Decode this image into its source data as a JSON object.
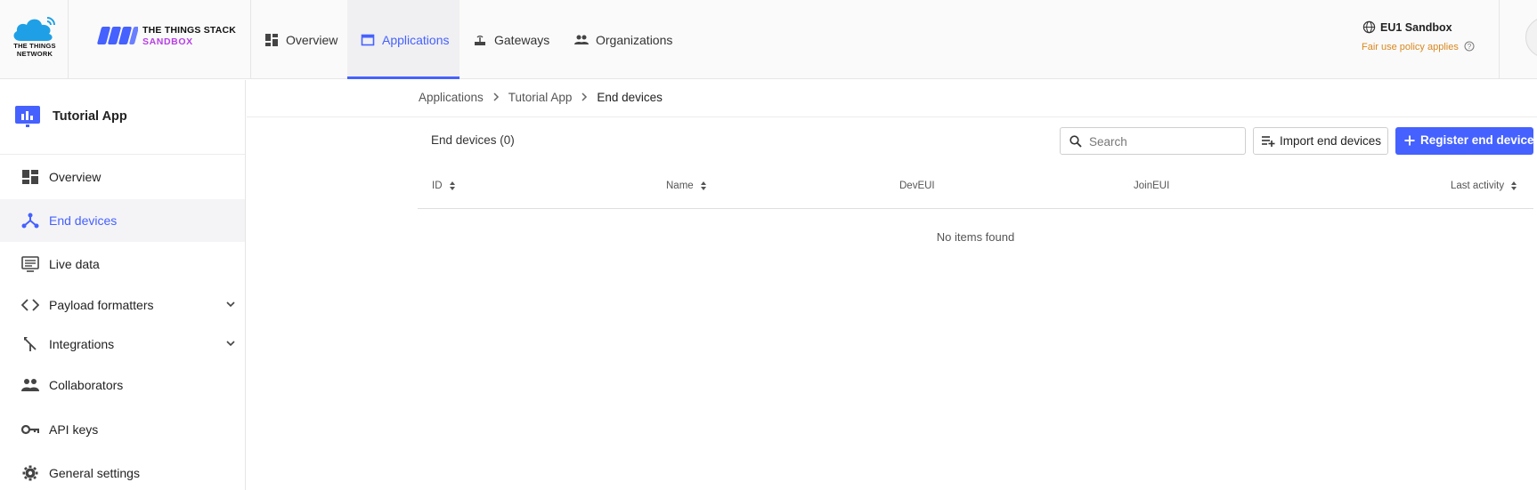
{
  "brand": {
    "ttn_logo_text": "THE THINGS\nNETWORK",
    "stack_line1": "THE THINGS STACK",
    "stack_line2": "SANDBOX"
  },
  "nav": {
    "items": [
      {
        "label": "Overview",
        "icon": "dashboard-icon",
        "active": false
      },
      {
        "label": "Applications",
        "icon": "window-icon",
        "active": true
      },
      {
        "label": "Gateways",
        "icon": "router-icon",
        "active": false
      },
      {
        "label": "Organizations",
        "icon": "people-icon",
        "active": false
      }
    ]
  },
  "region": {
    "name": "EU1 Sandbox",
    "policy": "Fair use policy applies"
  },
  "sidebar": {
    "app_name": "Tutorial App",
    "items": [
      {
        "label": "Overview",
        "icon": "dashboard-icon"
      },
      {
        "label": "End devices",
        "icon": "device-hub-icon",
        "active": true
      },
      {
        "label": "Live data",
        "icon": "monitor-icon"
      },
      {
        "label": "Payload formatters",
        "icon": "code-icon",
        "expandable": true
      },
      {
        "label": "Integrations",
        "icon": "merge-icon",
        "expandable": true
      },
      {
        "label": "Collaborators",
        "icon": "group-icon"
      },
      {
        "label": "API keys",
        "icon": "key-icon"
      },
      {
        "label": "General settings",
        "icon": "gear-icon"
      }
    ]
  },
  "breadcrumb": [
    "Applications",
    "Tutorial App",
    "End devices"
  ],
  "toolbar": {
    "title": "End devices (0)",
    "search_placeholder": "Search",
    "import_label": "Import end devices",
    "register_label": "Register end device"
  },
  "table": {
    "columns": [
      "ID",
      "Name",
      "DevEUI",
      "JoinEUI",
      "Last activity"
    ],
    "empty_text": "No items found"
  },
  "colors": {
    "accent": "#4561ff",
    "policy": "#d9881f",
    "sandbox": "#b63ee6"
  }
}
